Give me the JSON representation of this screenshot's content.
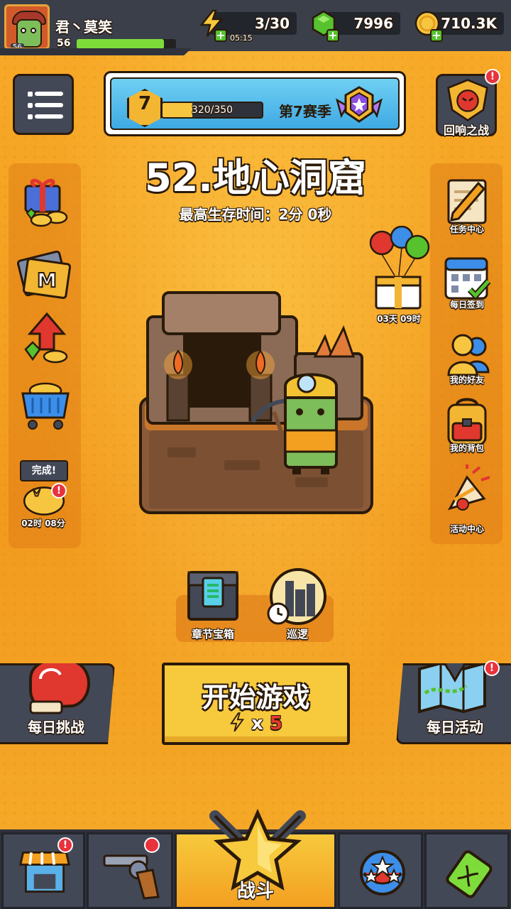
{
  "player": {
    "name": "君丶莫笑",
    "level": "56",
    "avatar_level": "56",
    "xp_fraction": 0.88
  },
  "resources": {
    "energy": "3/30",
    "energy_timer": "05:15",
    "gems": "7996",
    "coins": "710.3K"
  },
  "season": {
    "rank": "7",
    "progress": "320/350",
    "progress_fraction": 0.3,
    "name": "第7赛季"
  },
  "echo_battle": {
    "label": "回响之战",
    "badge": "!"
  },
  "stage": {
    "title": "52.地心洞窟",
    "best_time": "最高生存时间：2分 0秒"
  },
  "left_sidebar": {
    "items": [
      {
        "icon": "gift-coins-icon"
      },
      {
        "icon": "membership-card-icon"
      },
      {
        "icon": "gem-upgrade-icon"
      },
      {
        "icon": "shop-cart-icon"
      }
    ],
    "offline_reward": {
      "bubble": "完成!",
      "timer": "02时 08分",
      "badge": "!"
    }
  },
  "balloon_gift": {
    "timer": "03天 09时"
  },
  "right_sidebar": {
    "items": [
      {
        "label": "任务中心",
        "icon": "quest-scroll-icon"
      },
      {
        "label": "每日签到",
        "icon": "calendar-check-icon"
      },
      {
        "label": "我的好友",
        "icon": "friends-icon"
      },
      {
        "label": "我的背包",
        "icon": "backpack-icon"
      },
      {
        "label": "活动中心",
        "icon": "party-popper-icon"
      }
    ]
  },
  "chest": {
    "label": "章节宝箱"
  },
  "patrol": {
    "label": "巡逻"
  },
  "daily_challenge": {
    "label": "每日挑战"
  },
  "daily_event": {
    "label": "每日活动",
    "badge": "!"
  },
  "start_button": {
    "title": "开始游戏",
    "cost_prefix": "x",
    "cost": "5"
  },
  "nav": {
    "shop_badge": "!",
    "battle_label": "战斗"
  },
  "colors": {
    "background": "#f3a021",
    "accent_yellow": "#f7c93c",
    "panel_dark": "#434857",
    "badge_red": "#e7333d",
    "gem_green": "#55c22e"
  }
}
